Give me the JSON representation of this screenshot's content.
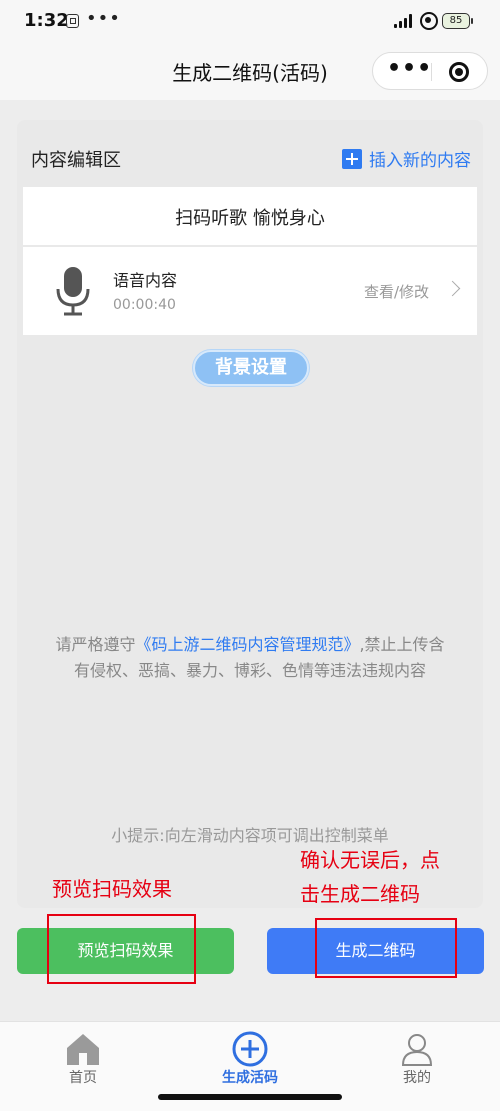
{
  "status_bar": {
    "time": "1:32",
    "battery": "85"
  },
  "nav": {
    "title": "生成二维码(活码)"
  },
  "editor": {
    "header_label": "内容编辑区",
    "insert_label": "插入新的内容",
    "title_text": "扫码听歌 愉悦身心",
    "audio": {
      "name": "语音内容",
      "duration": "00:00:40",
      "action": "查看/修改"
    },
    "bg_settings_label": "背景设置",
    "notice_prefix": "请严格遵守",
    "notice_link": "《码上游二维码内容管理规范》",
    "notice_suffix": ",禁止上传含有侵权、恶搞、暴力、博彩、色情等违法违规内容",
    "tip": "小提示:向左滑动内容项可调出控制菜单"
  },
  "annotations": {
    "left": "预览扫码效果",
    "right_line1": "确认无误后，点",
    "right_line2": "击生成二维码"
  },
  "buttons": {
    "preview": "预览扫码效果",
    "generate": "生成二维码"
  },
  "tabs": [
    {
      "label": "首页",
      "icon": "home-icon"
    },
    {
      "label": "生成活码",
      "icon": "add-circle-icon",
      "active": true
    },
    {
      "label": "我的",
      "icon": "user-icon"
    }
  ],
  "colors": {
    "primary_blue": "#3f7bf6",
    "green": "#4cbf5f",
    "annotation_red": "#e60012",
    "link_blue": "#2f7bf1"
  }
}
